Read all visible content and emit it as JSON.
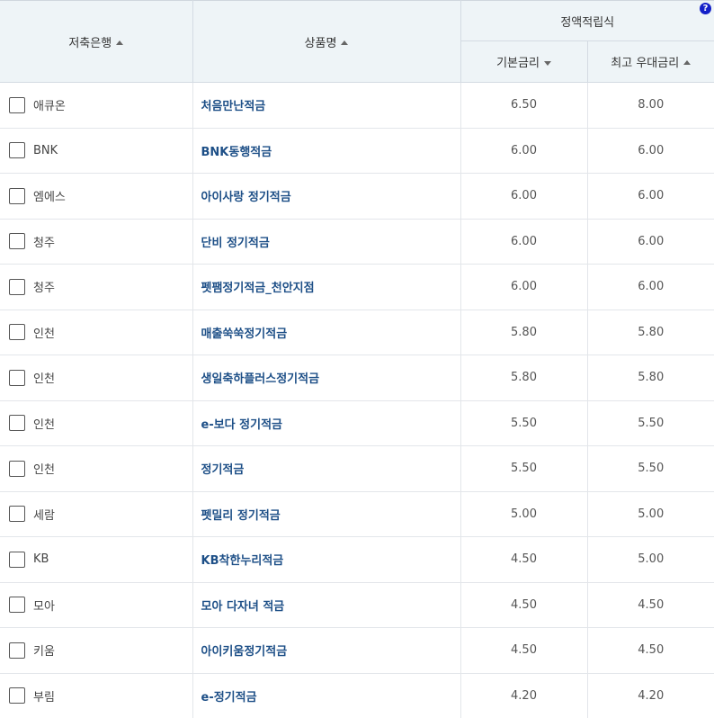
{
  "header": {
    "bank": "저축은행",
    "product": "상품명",
    "group": "정액적립식",
    "base_rate": "기본금리",
    "max_rate": "최고 우대금리",
    "help": "?"
  },
  "rows": [
    {
      "bank": "애큐온",
      "product": "처음만난적금",
      "base": "6.50",
      "max": "8.00"
    },
    {
      "bank": "BNK",
      "product": "BNK동행적금",
      "base": "6.00",
      "max": "6.00"
    },
    {
      "bank": "엠에스",
      "product": "아이사랑 정기적금",
      "base": "6.00",
      "max": "6.00"
    },
    {
      "bank": "청주",
      "product": "단비 정기적금",
      "base": "6.00",
      "max": "6.00"
    },
    {
      "bank": "청주",
      "product": "펫팸정기적금_천안지점",
      "base": "6.00",
      "max": "6.00"
    },
    {
      "bank": "인천",
      "product": "매출쑥쑥정기적금",
      "base": "5.80",
      "max": "5.80"
    },
    {
      "bank": "인천",
      "product": "생일축하플러스정기적금",
      "base": "5.80",
      "max": "5.80"
    },
    {
      "bank": "인천",
      "product": "e-보다 정기적금",
      "base": "5.50",
      "max": "5.50"
    },
    {
      "bank": "인천",
      "product": "정기적금",
      "base": "5.50",
      "max": "5.50"
    },
    {
      "bank": "세람",
      "product": "펫밀리 정기적금",
      "base": "5.00",
      "max": "5.00"
    },
    {
      "bank": "KB",
      "product": "KB착한누리적금",
      "base": "4.50",
      "max": "5.00"
    },
    {
      "bank": "모아",
      "product": "모아 다자녀 적금",
      "base": "4.50",
      "max": "4.50"
    },
    {
      "bank": "키움",
      "product": "아이키움정기적금",
      "base": "4.50",
      "max": "4.50"
    },
    {
      "bank": "부림",
      "product": "e-정기적금",
      "base": "4.20",
      "max": "4.20"
    }
  ]
}
